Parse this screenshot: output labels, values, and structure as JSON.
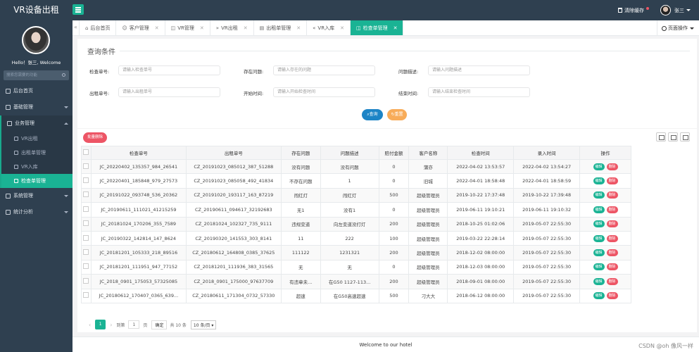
{
  "app": {
    "title": "VR设备出租"
  },
  "header": {
    "clear_cache": "清除缓存",
    "user": "张三"
  },
  "sidebar": {
    "greeting": "Hello！张三, Welcome",
    "search_placeholder": "搜索您需要的功能",
    "items": [
      {
        "label": "后台首页"
      },
      {
        "label": "基础管理"
      },
      {
        "label": "业务管理"
      },
      {
        "label": "系统管理"
      },
      {
        "label": "统计分析"
      }
    ],
    "subitems": [
      {
        "label": "VR出租"
      },
      {
        "label": "出租单管理"
      },
      {
        "label": "VR入库"
      },
      {
        "label": "检查单管理"
      }
    ]
  },
  "tabs": [
    {
      "label": "后台首页"
    },
    {
      "label": "客户管理"
    },
    {
      "label": "VR管理"
    },
    {
      "label": "VR出租"
    },
    {
      "label": "出租单管理"
    },
    {
      "label": "VR入库"
    },
    {
      "label": "检查单管理"
    }
  ],
  "page_op": "页面操作",
  "query": {
    "title": "查询条件",
    "fields": [
      {
        "label": "检查单号:",
        "placeholder": "请输入检查单号"
      },
      {
        "label": "存在问题:",
        "placeholder": "请输入存在的问题"
      },
      {
        "label": "问题描述:",
        "placeholder": "请输入问题描述"
      },
      {
        "label": "出租单号:",
        "placeholder": "请输入出租单号"
      },
      {
        "label": "开始时间:",
        "placeholder": "请输入开始检查时间"
      },
      {
        "label": "结束时间:",
        "placeholder": "请输入结束检查时间"
      }
    ],
    "search": "查询",
    "reset": "重置"
  },
  "table": {
    "batch_delete": "批量删除",
    "headers": [
      "检查单号",
      "出租单号",
      "存在问题",
      "问题描述",
      "赔付金额",
      "客户名称",
      "检查时间",
      "录入时间",
      "操作"
    ],
    "edit_label": "编辑",
    "delete_label": "删除",
    "rows": [
      [
        "JC_20220402_135357_984_26541",
        "CZ_20191023_085012_387_51288",
        "没有问题",
        "没有问题",
        "0",
        "蒲亦",
        "2022-04-02 13:53:57",
        "2022-04-02 13:54:27"
      ],
      [
        "JC_20220401_185848_979_27573",
        "CZ_20191023_085058_492_41834",
        "不存在问题",
        "1",
        "0",
        "旧城",
        "2022-04-01 18:58:48",
        "2022-04-01 18:58:59"
      ],
      [
        "JC_20191022_093748_536_20362",
        "CZ_20191020_193117_163_87219",
        "闯红灯",
        "闯红灯",
        "500",
        "超级管理员",
        "2019-10-22 17:37:48",
        "2019-10-22 17:39:48"
      ],
      [
        "JC_20190611_111021_41215259",
        "CZ_20190611_094617_32192683",
        "无1",
        "没有1",
        "0",
        "超级管理员",
        "2019-06-11 19:10:21",
        "2019-06-11 19:10:32"
      ],
      [
        "JC_20181024_170206_355_7589",
        "CZ_20181024_102327_735_9111",
        "违规变道",
        "向左变道没打灯",
        "200",
        "超级管理员",
        "2018-10-25 01:02:06",
        "2019-05-07 22:55:30"
      ],
      [
        "JC_20190322_142814_147_8624",
        "CZ_20190320_141553_303_8141",
        "11",
        "222",
        "100",
        "超级管理员",
        "2019-03-22 22:28:14",
        "2019-05-07 22:55:30"
      ],
      [
        "JC_20181201_105333_218_89516",
        "CZ_20180612_164808_0385_37625",
        "111122",
        "1231321",
        "200",
        "超级管理员",
        "2018-12-02 08:00:00",
        "2019-05-07 22:55:30"
      ],
      [
        "JC_20181201_111951_947_77152",
        "CZ_20181201_111936_383_31565",
        "无",
        "无",
        "0",
        "超级管理员",
        "2018-12-03 08:00:00",
        "2019-05-07 22:55:30"
      ],
      [
        "JC_2018_0901_175053_57325085",
        "CZ_2018_0901_175000_97637709",
        "有违章未...",
        "在G50 1127-113...",
        "200",
        "超级管理员",
        "2018-09-01 08:00:00",
        "2019-05-07 22:55:30"
      ],
      [
        "JC_20180612_170407_0365_639...",
        "CZ_20180611_171304_0732_57330",
        "超速",
        "在G50高速超速",
        "500",
        "刁大大",
        "2018-06-12 08:00:00",
        "2019-05-07 22:55:30"
      ]
    ]
  },
  "pager": {
    "current": "1",
    "goto_prefix": "到第",
    "goto_value": "1",
    "page_unit": "页",
    "confirm": "确定",
    "total": "共 10 条",
    "size": "10 条/页"
  },
  "footer": {
    "text": "Welcome to our hotel"
  },
  "watermark": "CSDN @oh 像风一样"
}
